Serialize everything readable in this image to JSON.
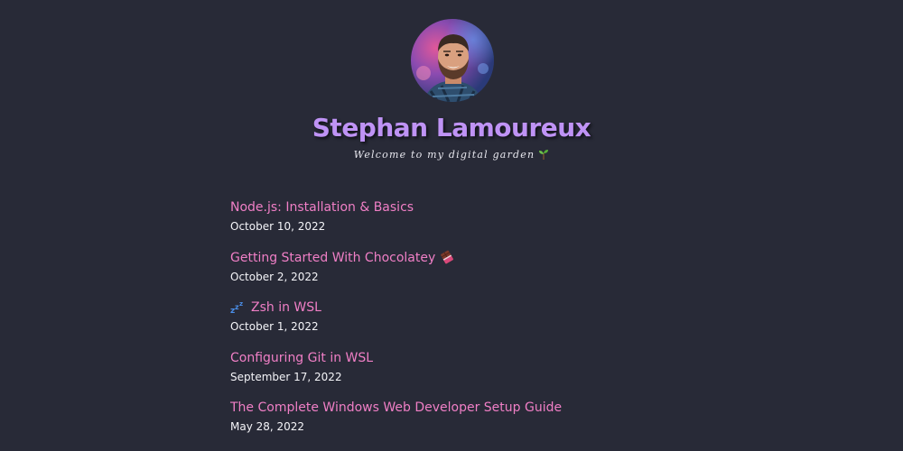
{
  "header": {
    "avatar_alt": "Stephan Lamoureux",
    "title": "Stephan Lamoureux",
    "tagline": "Welcome to my digital garden",
    "tagline_icon": "seedling-icon"
  },
  "posts": [
    {
      "title": "Node.js: Installation & Basics",
      "date": "October 10, 2022",
      "icon": ""
    },
    {
      "title": "Getting Started With Chocolatey",
      "date": "October 2, 2022",
      "icon": "chocolate-bar-icon"
    },
    {
      "title": "Zsh in WSL",
      "date": "October 1, 2022",
      "icon": "sleeping-zzz-icon"
    },
    {
      "title": "Configuring Git in WSL",
      "date": "September 17, 2022",
      "icon": ""
    },
    {
      "title": "The Complete Windows Web Developer Setup Guide",
      "date": "May 28, 2022",
      "icon": ""
    }
  ],
  "colors": {
    "background": "#282a37",
    "title": "#bf93f5",
    "link": "#f07fc6",
    "text": "#f4f4f8"
  }
}
